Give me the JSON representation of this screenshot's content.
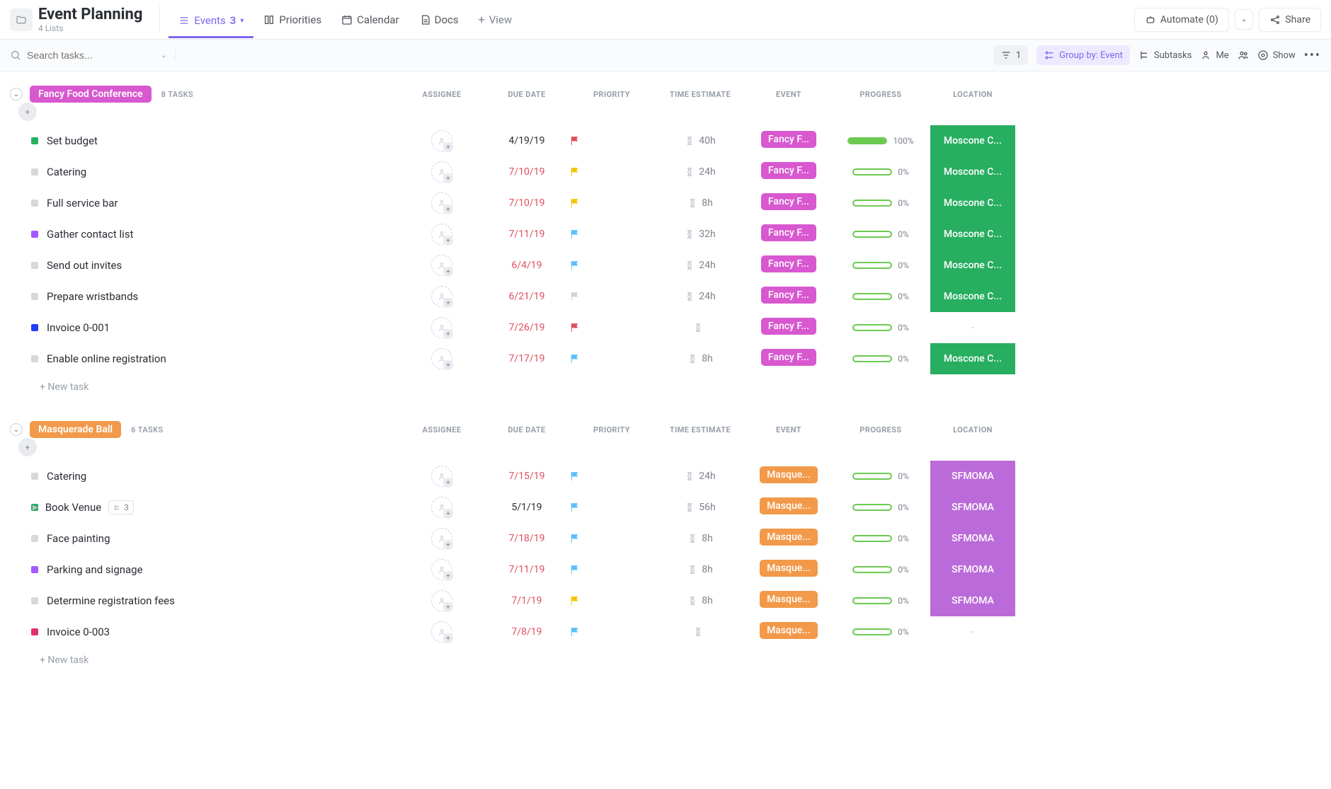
{
  "header": {
    "title": "Event Planning",
    "subtitle": "4 Lists",
    "tabs": [
      {
        "label": "Events",
        "count": "3",
        "active": true
      },
      {
        "label": "Priorities"
      },
      {
        "label": "Calendar"
      },
      {
        "label": "Docs"
      }
    ],
    "addView": "View",
    "automate": "Automate (0)",
    "share": "Share"
  },
  "toolbar": {
    "searchPlaceholder": "Search tasks...",
    "filterCount": "1",
    "groupBy": "Group by: Event",
    "subtasks": "Subtasks",
    "me": "Me",
    "show": "Show"
  },
  "columns": [
    "ASSIGNEE",
    "DUE DATE",
    "PRIORITY",
    "TIME ESTIMATE",
    "EVENT",
    "PROGRESS",
    "LOCATION"
  ],
  "newTask": "+ New task",
  "groups": [
    {
      "name": "Fancy Food Conference",
      "color": "#d858d0",
      "countLabel": "8 TASKS",
      "eventPill": "Fancy F...",
      "locColor": "#27ae60",
      "tasks": [
        {
          "statusColor": "#27ae60",
          "name": "Set budget",
          "date": "4/19/19",
          "dateRed": false,
          "flag": "red",
          "est": "40h",
          "progress": 100,
          "loc": "Moscone C..."
        },
        {
          "statusColor": "#d8d8d8",
          "name": "Catering",
          "date": "7/10/19",
          "dateRed": true,
          "flag": "yellow",
          "est": "24h",
          "progress": 0,
          "loc": "Moscone C..."
        },
        {
          "statusColor": "#d8d8d8",
          "name": "Full service bar",
          "date": "7/10/19",
          "dateRed": true,
          "flag": "yellow",
          "est": "8h",
          "progress": 0,
          "loc": "Moscone C..."
        },
        {
          "statusColor": "#a259ff",
          "name": "Gather contact list",
          "date": "7/11/19",
          "dateRed": true,
          "flag": "blue",
          "est": "32h",
          "progress": 0,
          "loc": "Moscone C..."
        },
        {
          "statusColor": "#d8d8d8",
          "name": "Send out invites",
          "date": "6/4/19",
          "dateRed": true,
          "flag": "blue",
          "est": "24h",
          "progress": 0,
          "loc": "Moscone C..."
        },
        {
          "statusColor": "#d8d8d8",
          "name": "Prepare wristbands",
          "date": "6/21/19",
          "dateRed": true,
          "flag": "gray",
          "est": "24h",
          "progress": 0,
          "loc": "Moscone C..."
        },
        {
          "statusColor": "#1f3cff",
          "name": "Invoice 0-001",
          "date": "7/26/19",
          "dateRed": true,
          "flag": "red",
          "est": "",
          "progress": 0,
          "loc": "-"
        },
        {
          "statusColor": "#d8d8d8",
          "name": "Enable online registration",
          "date": "7/17/19",
          "dateRed": true,
          "flag": "blue",
          "est": "8h",
          "progress": 0,
          "loc": "Moscone C..."
        }
      ]
    },
    {
      "name": "Masquerade Ball",
      "color": "#f2994a",
      "countLabel": "6 TASKS",
      "eventPill": "Masque...",
      "locColor": "#bb6bd9",
      "tasks": [
        {
          "statusColor": "#d8d8d8",
          "name": "Catering",
          "date": "7/15/19",
          "dateRed": true,
          "flag": "blue",
          "est": "24h",
          "progress": 0,
          "loc": "SFMOMA"
        },
        {
          "statusColor": "#27ae60",
          "name": "Book Venue",
          "date": "5/1/19",
          "dateRed": false,
          "flag": "blue",
          "est": "56h",
          "progress": 0,
          "loc": "SFMOMA",
          "subtasks": "3",
          "expandable": true
        },
        {
          "statusColor": "#d8d8d8",
          "name": "Face painting",
          "date": "7/18/19",
          "dateRed": true,
          "flag": "blue",
          "est": "8h",
          "progress": 0,
          "loc": "SFMOMA"
        },
        {
          "statusColor": "#a259ff",
          "name": "Parking and signage",
          "date": "7/11/19",
          "dateRed": true,
          "flag": "blue",
          "est": "8h",
          "progress": 0,
          "loc": "SFMOMA"
        },
        {
          "statusColor": "#d8d8d8",
          "name": "Determine registration fees",
          "date": "7/1/19",
          "dateRed": true,
          "flag": "yellow",
          "est": "8h",
          "progress": 0,
          "loc": "SFMOMA"
        },
        {
          "statusColor": "#e0316e",
          "name": "Invoice 0-003",
          "date": "7/8/19",
          "dateRed": true,
          "flag": "blue",
          "est": "",
          "progress": 0,
          "loc": "-"
        }
      ]
    }
  ]
}
